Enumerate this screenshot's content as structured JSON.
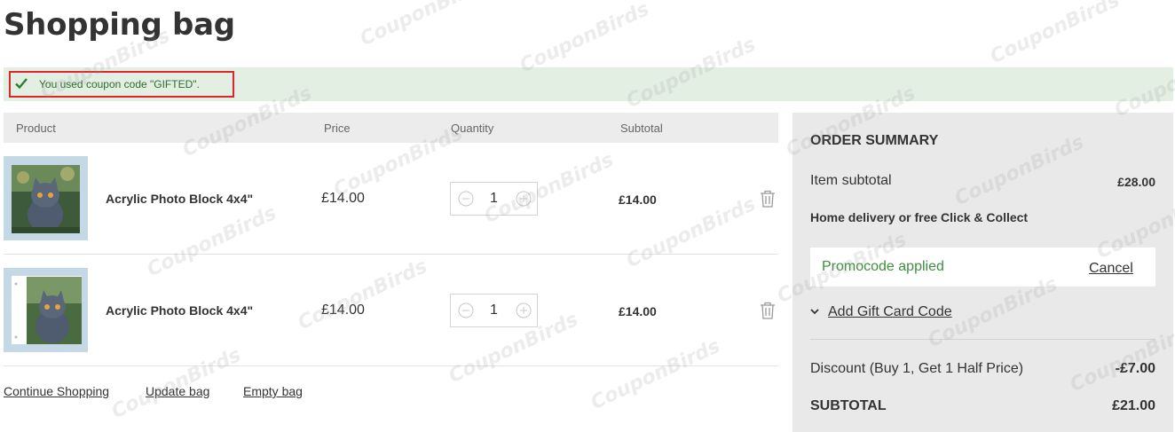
{
  "page": {
    "title": "Shopping bag"
  },
  "notice": {
    "text": "You used coupon code \"GIFTED\"."
  },
  "table": {
    "headers": {
      "product": "Product",
      "price": "Price",
      "quantity": "Quantity",
      "subtotal": "Subtotal"
    },
    "items": [
      {
        "name": "Acrylic Photo Block 4x4\"",
        "price": "£14.00",
        "quantity": "1",
        "subtotal": "£14.00"
      },
      {
        "name": "Acrylic Photo Block 4x4\"",
        "price": "£14.00",
        "quantity": "1",
        "subtotal": "£14.00"
      }
    ]
  },
  "footer_links": {
    "continue": "Continue Shopping",
    "update": "Update bag",
    "empty": "Empty bag"
  },
  "summary": {
    "title": "ORDER SUMMARY",
    "item_subtotal_label": "Item subtotal",
    "item_subtotal_value": "£28.00",
    "delivery": "Home delivery or free Click & Collect",
    "promo_text": "Promocode applied",
    "promo_cancel": "Cancel",
    "gift_card": "Add Gift Card Code",
    "discount_label": "Discount (Buy 1, Get 1 Half Price)",
    "discount_value": "-£7.00",
    "subtotal_label": "SUBTOTAL",
    "subtotal_value": "£21.00"
  },
  "watermark": {
    "text": "CouponBirds"
  }
}
